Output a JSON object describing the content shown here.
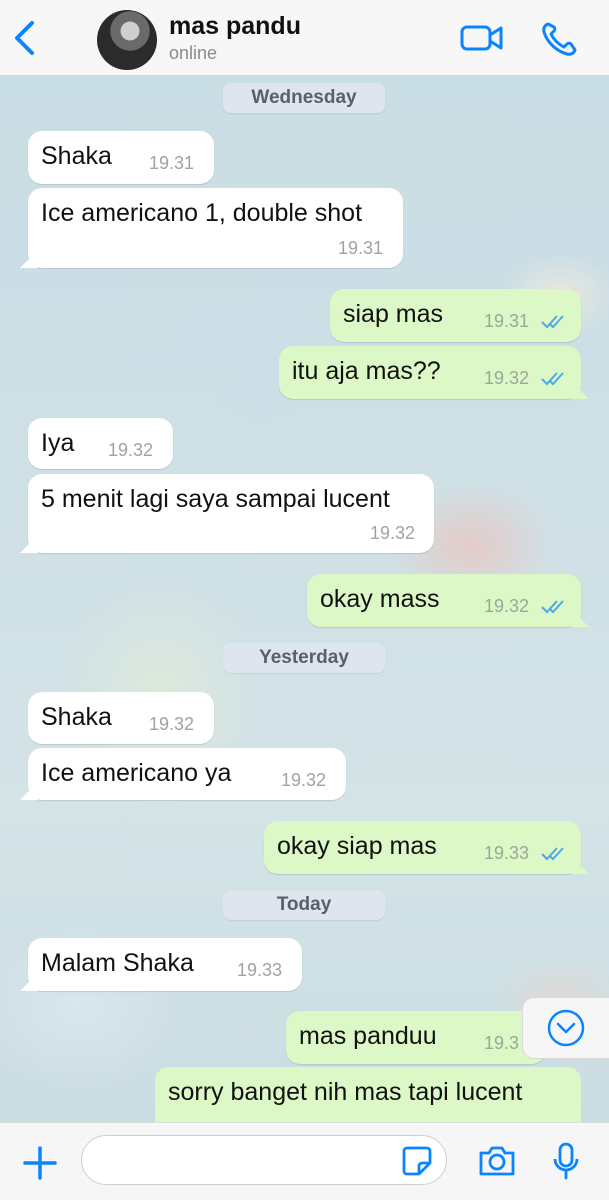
{
  "header": {
    "contact_name": "mas pandu",
    "status": "online",
    "icons": [
      "chevron-left-icon",
      "video-camera-icon",
      "phone-icon"
    ],
    "accent_color": "#0a84ff"
  },
  "date_labels": [
    "Wednesday",
    "Yesterday",
    "Today"
  ],
  "messages": [
    {
      "dir": "in",
      "text": "Shaka",
      "time": "19.31"
    },
    {
      "dir": "in",
      "text": "Ice americano 1, double shot",
      "time": "19.31"
    },
    {
      "dir": "out",
      "text": "siap mas",
      "time": "19.31",
      "status": "read"
    },
    {
      "dir": "out",
      "text": "itu aja mas??",
      "time": "19.32",
      "status": "read"
    },
    {
      "dir": "in",
      "text": "Iya",
      "time": "19.32"
    },
    {
      "dir": "in",
      "text": "5 menit lagi saya sampai lucent",
      "time": "19.32"
    },
    {
      "dir": "out",
      "text": "okay mass",
      "time": "19.32",
      "status": "read"
    },
    {
      "dir": "in",
      "text": "Shaka",
      "time": "19.32"
    },
    {
      "dir": "in",
      "text": "Ice americano ya",
      "time": "19.32"
    },
    {
      "dir": "out",
      "text": "okay siap mas",
      "time": "19.33",
      "status": "read"
    },
    {
      "dir": "in",
      "text": "Malam Shaka",
      "time": "19.33"
    },
    {
      "dir": "out",
      "text": "mas panduu",
      "time": "19.3"
    },
    {
      "dir": "out",
      "text": "sorry banget nih mas tapi lucent",
      "time": ""
    }
  ],
  "composer": {
    "placeholder": "",
    "icons": [
      "plus-icon",
      "sticker-icon",
      "camera-icon",
      "microphone-icon"
    ]
  },
  "colors": {
    "incoming_bubble": "#ffffff",
    "outgoing_bubble": "#dcf8c6",
    "read_ticks": "#4fa8e6"
  }
}
